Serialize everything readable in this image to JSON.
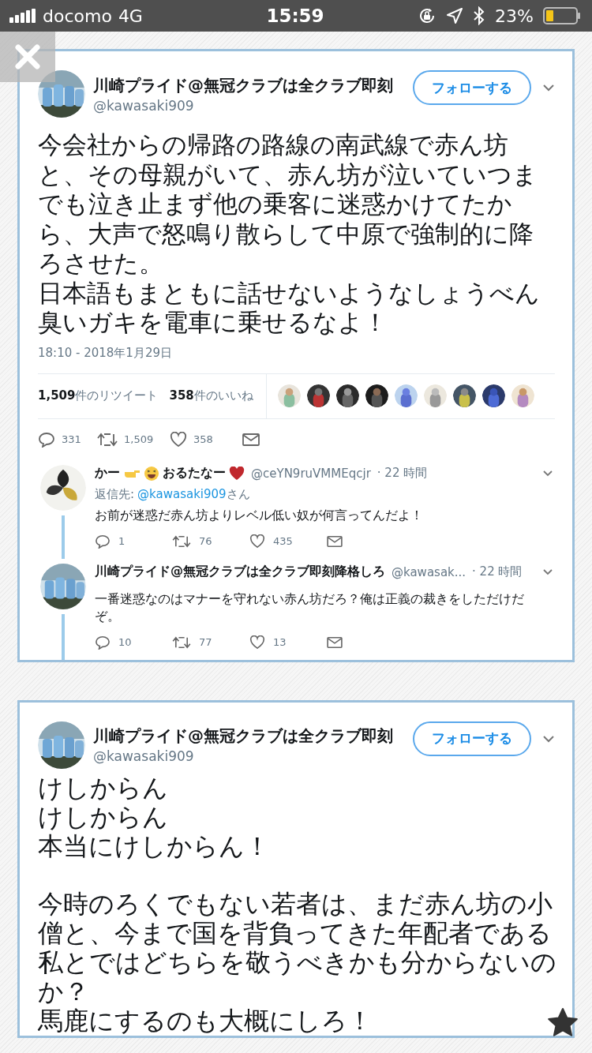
{
  "status_bar": {
    "carrier": "docomo",
    "network": "4G",
    "time": "15:59",
    "battery": "23%"
  },
  "tweets": [
    {
      "display_name": "川崎プライド@無冠クラブは全クラブ即刻",
      "handle": "@kawasaki909",
      "follow_label": "フォローする",
      "paragraphs": [
        [
          "今会社からの帰路の路線の南武線で赤ん坊と、その母親がいて、赤ん坊が泣いていつまでも泣き止まず他の乗客に迷惑かけてたから、大声で怒鳴り散らして中原で強制的に降ろさせた。",
          "日本語もまともに話せないようなしょうべん臭いガキを電車に乗せるなよ！"
        ]
      ],
      "timestamp": "18:10 - 2018年1月29日",
      "stats": {
        "retweet_count": "1,509",
        "retweet_label": "件のリツイート",
        "like_count": "358",
        "like_label": "件のいいね"
      },
      "liker_avatars": [
        {
          "kind": "picture"
        },
        {
          "kind": "picture"
        },
        {
          "kind": "picture"
        },
        {
          "kind": "picture"
        },
        {
          "kind": "picture"
        },
        {
          "kind": "picture"
        },
        {
          "kind": "picture"
        },
        {
          "kind": "picture"
        },
        {
          "kind": "picture"
        }
      ],
      "actions": {
        "replies": "331",
        "retweets": "1,509",
        "likes": "358"
      },
      "replies": [
        {
          "name": [
            {
              "kind": "text",
              "text": "かー"
            },
            {
              "kind": "pointing-hand"
            },
            {
              "kind": "laughing-face"
            },
            {
              "kind": "text",
              "text": "おるたなー"
            },
            {
              "kind": "heart"
            }
          ],
          "handle": "@ceYN9ruVMMEqcjr",
          "time": "· 22 時間",
          "reply_to_label": "返信先:",
          "reply_to": "@kawasaki909",
          "reply_to_suffix": "さん",
          "text": "お前が迷惑だ赤ん坊よりレベル低い奴が何言ってんだよ！",
          "replies": "1",
          "retweets": "76",
          "likes": "435"
        },
        {
          "name": [
            {
              "kind": "text",
              "text": "川崎プライド@無冠クラブは全クラブ即刻降格しろ"
            }
          ],
          "handle": "@kawasak...",
          "time": "· 22 時間",
          "text": "一番迷惑なのはマナーを守れない赤ん坊だろ？俺は正義の裁きをしただけだぞ。",
          "replies": "10",
          "retweets": "77",
          "likes": "13"
        }
      ]
    },
    {
      "display_name": "川崎プライド@無冠クラブは全クラブ即刻",
      "handle": "@kawasaki909",
      "follow_label": "フォローする",
      "paragraphs": [
        [
          "けしからん",
          "けしからん",
          "本当にけしからん！"
        ],
        [
          "今時のろくでもない若者は、まだ赤ん坊の小僧と、今まで国を背負ってきた年配者である私とではどちらを敬うべきかも分からないのか？",
          "馬鹿にするのも大概にしろ！"
        ]
      ]
    }
  ]
}
